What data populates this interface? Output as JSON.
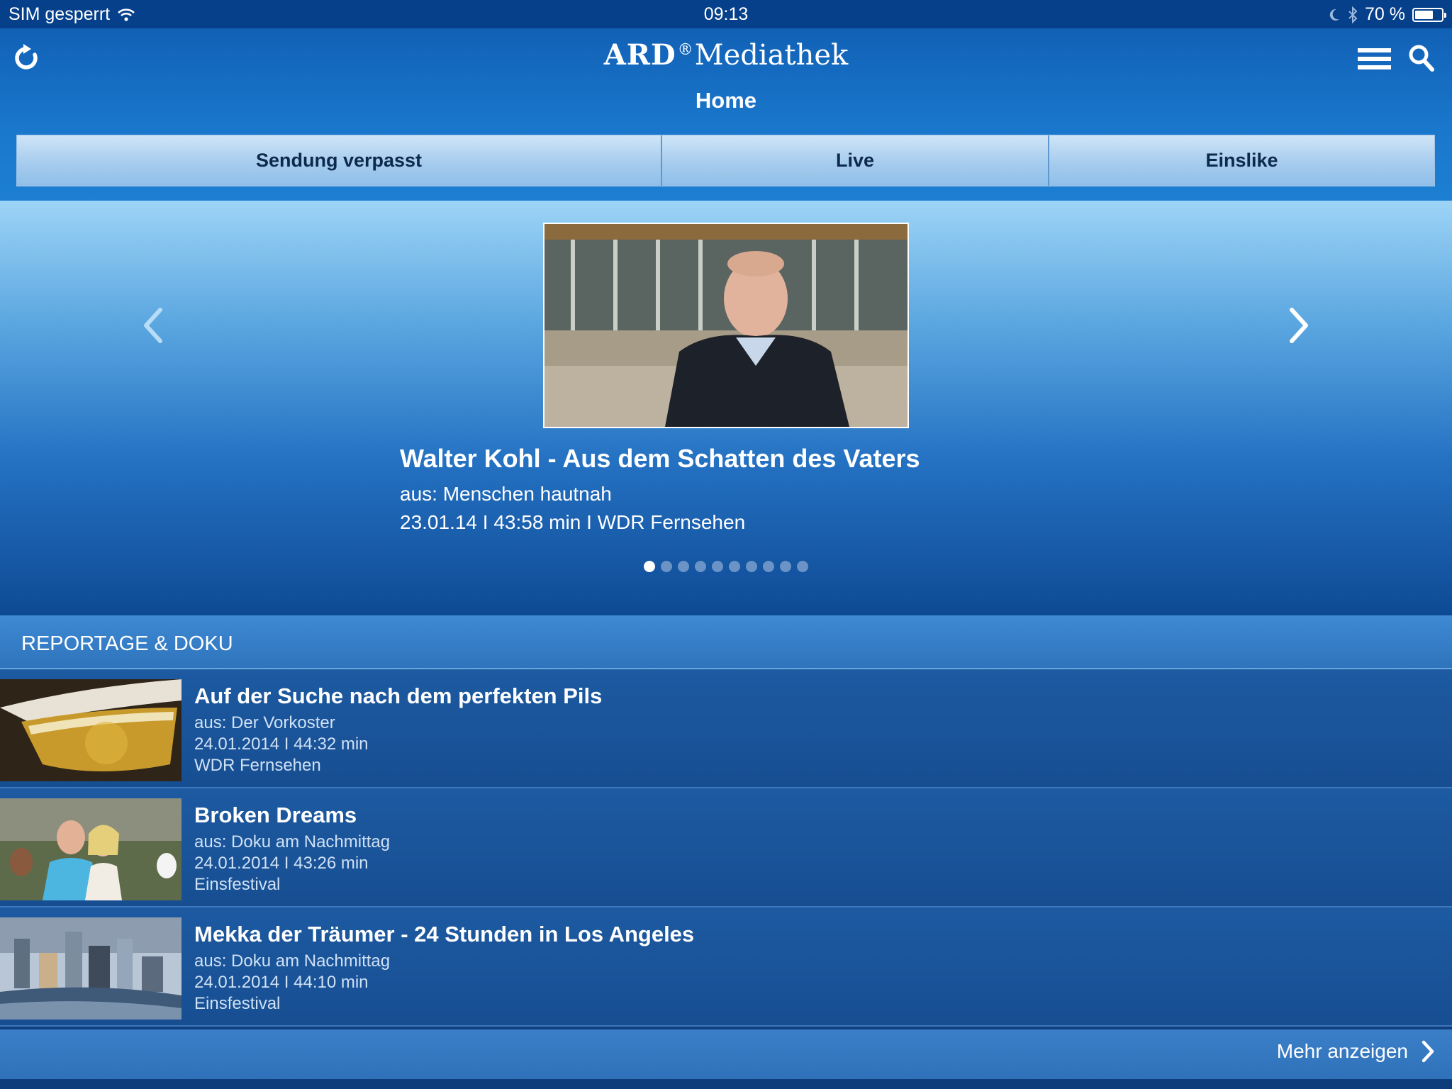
{
  "status_bar": {
    "carrier": "SIM gesperrt",
    "time": "09:13",
    "battery": "70 %",
    "battery_level": 0.7
  },
  "header": {
    "logo_ard": "ARD",
    "logo_mark": "®",
    "logo_mediathek": "Mediathek",
    "title": "Home",
    "icons": [
      "refresh-icon",
      "menu-icon",
      "search-icon"
    ]
  },
  "tabs": [
    {
      "label": "Sendung verpasst"
    },
    {
      "label": "Live"
    },
    {
      "label": "Einslike"
    }
  ],
  "hero": {
    "title": "Walter Kohl - Aus dem Schatten des Vaters",
    "subtitle": "aus: Menschen hautnah",
    "meta": "23.01.14 I 43:58 min I WDR Fernsehen",
    "dot_count": 10,
    "active_dot": 0
  },
  "section": {
    "title": "REPORTAGE & DOKU"
  },
  "items": [
    {
      "title": "Auf der Suche nach dem perfekten Pils",
      "series": "aus: Der Vorkoster",
      "meta": "24.01.2014 I 44:32 min",
      "channel": "WDR Fernsehen"
    },
    {
      "title": "Broken Dreams",
      "series": "aus: Doku am Nachmittag",
      "meta": "24.01.2014 I 43:26 min",
      "channel": "Einsfestival"
    },
    {
      "title": "Mekka der Träumer - 24 Stunden in Los Angeles",
      "series": "aus: Doku am Nachmittag",
      "meta": "24.01.2014 I 44:10 min",
      "channel": "Einsfestival"
    }
  ],
  "more": {
    "label": "Mehr anzeigen"
  },
  "colors": {
    "accent": "#1a78cc",
    "tab_bg": "#a6ccee",
    "tab_text": "#0d2a4d",
    "list_bg": "#1d5aa1"
  }
}
